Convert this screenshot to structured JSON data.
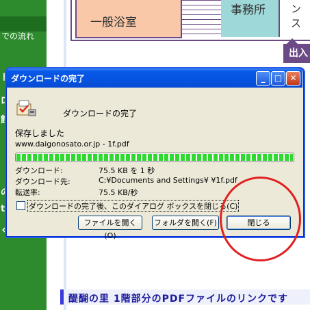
{
  "page": {
    "sidebar": {
      "item_text": "での流れ",
      "marks": [
        "ト",
        "ロ",
        "館",
        "の",
        "t",
        "く"
      ]
    },
    "floor_plan": {
      "room_bath": "一般浴室",
      "room_office": "事務所",
      "room_right": "ンス",
      "entrance": "出入"
    },
    "bottom_link": "醍醐の里 1階部分のPDFファイルのリンクです"
  },
  "dialog": {
    "title": "ダウンロードの完了",
    "heading": "ダウンロードの完了",
    "saved": "保存しました",
    "url": "www.daigonosato.or.jp - 1f.pdf",
    "progress_percent": 100,
    "info": [
      {
        "label": "ダウンロード:",
        "value": "75.5 KB を 1 秒"
      },
      {
        "label": "ダウンロード先:",
        "value": "C:¥Documents and Settings¥     ¥1f.pdf"
      },
      {
        "label": "転送率:",
        "value": "75.5 KB/秒"
      }
    ],
    "checkbox_label": "ダウンロードの完了後、このダイアログ ボックスを閉じる(C)",
    "checkbox_checked": false,
    "buttons": {
      "open_file": "ファイルを開く(O)",
      "open_folder": "フォルダを開く(F)",
      "close": "閉じる"
    },
    "title_buttons": {
      "minimize": "_",
      "maximize": "□",
      "close": "✕"
    }
  },
  "colors": {
    "sidebar_green": "#2d8a2d",
    "dialog_bg": "#ece9d8",
    "titlebar_blue": "#0553e0",
    "highlight_circle": "#e02020"
  }
}
